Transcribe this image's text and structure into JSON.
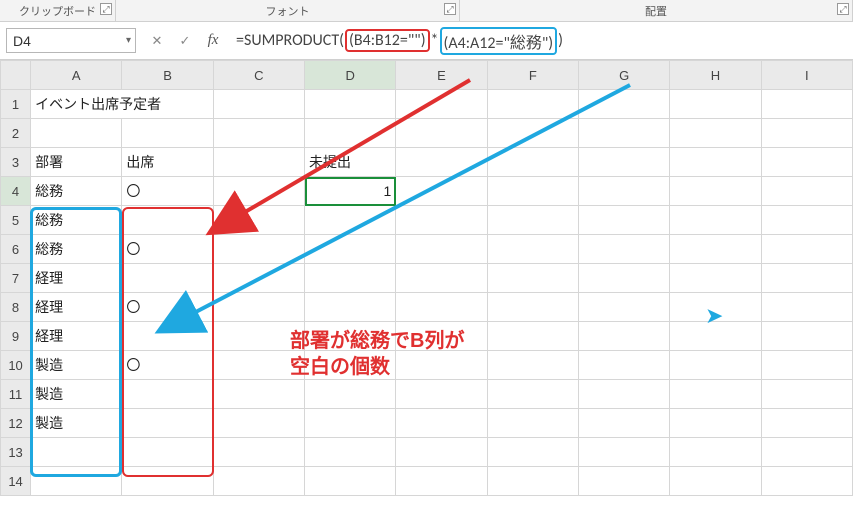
{
  "ribbon": {
    "clipboard": "クリップボード",
    "font": "フォント",
    "alignment": "配置"
  },
  "namebox": "D4",
  "formula": {
    "prefix": "=SUMPRODUCT(",
    "part1": "(B4:B12=\"\")",
    "mult": "*",
    "part2": "(A4:A12=\"総務\")",
    "suffix": ")"
  },
  "columns": [
    "A",
    "B",
    "C",
    "D",
    "E",
    "F",
    "G",
    "H",
    "I"
  ],
  "rows": [
    "1",
    "2",
    "3",
    "4",
    "5",
    "6",
    "7",
    "8",
    "9",
    "10",
    "11",
    "12",
    "13",
    "14"
  ],
  "cells": {
    "A1": "イベント出席予定者",
    "A3": "部署",
    "B3": "出席",
    "A4": "総務",
    "B4": "〇",
    "A5": "総務",
    "A6": "総務",
    "B6": "〇",
    "A7": "経理",
    "A8": "経理",
    "B8": "〇",
    "A9": "経理",
    "A10": "製造",
    "B10": "〇",
    "A11": "製造",
    "A12": "製造",
    "D3": "未提出",
    "D4": "1"
  },
  "annotation": {
    "line1": "部署が総務でB列が",
    "line2": "空白の個数"
  },
  "icons": {
    "dialog_launcher": "⤢",
    "dropdown": "▾",
    "cancel": "✕",
    "enter": "✓",
    "fx": "fx",
    "paper_plane": "➤"
  },
  "chart_data": {
    "type": "table",
    "title": "イベント出席予定者",
    "columns": [
      "部署",
      "出席"
    ],
    "rows": [
      {
        "部署": "総務",
        "出席": "〇"
      },
      {
        "部署": "総務",
        "出席": ""
      },
      {
        "部署": "総務",
        "出席": "〇"
      },
      {
        "部署": "経理",
        "出席": ""
      },
      {
        "部署": "経理",
        "出席": "〇"
      },
      {
        "部署": "経理",
        "出席": ""
      },
      {
        "部署": "製造",
        "出席": "〇"
      },
      {
        "部署": "製造",
        "出席": ""
      },
      {
        "部署": "製造",
        "出席": ""
      }
    ],
    "summary": {
      "label": "未提出",
      "formula": "=SUMPRODUCT((B4:B12=\"\")*(A4:A12=\"総務\"))",
      "value": 1
    }
  }
}
